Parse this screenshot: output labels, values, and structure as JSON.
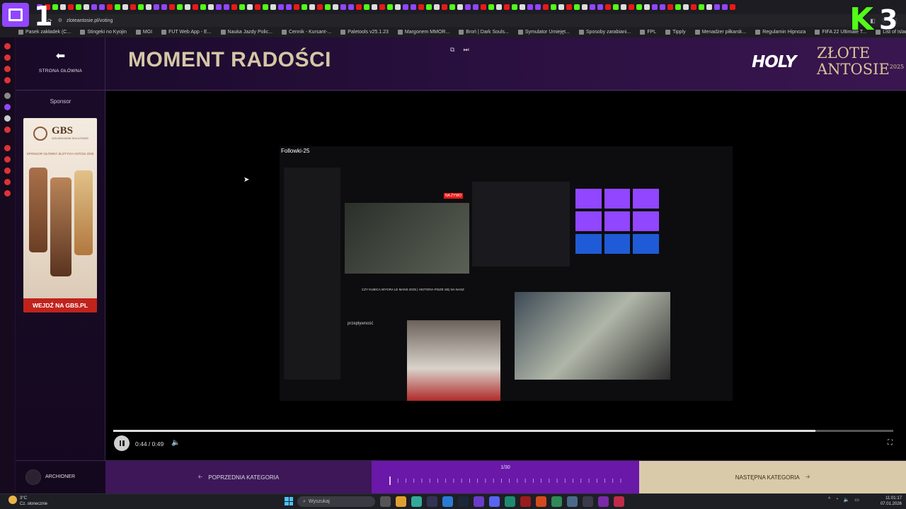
{
  "browser": {
    "url": "zloteantosie.pl/voting",
    "bookmarks": [
      "Pasek zakładek (C...",
      "Stingeki no Kyojin",
      "MGI",
      "FUT Web App - E...",
      "Nauka Jazdy Polic...",
      "Cennik - Kursant-...",
      "Paletools v25.1.23",
      "Margonem MMOR...",
      "Broń | Dark Souls...",
      "Symulator Umiejęt...",
      "Sposoby zarabiani...",
      "FPL",
      "Tipply",
      "Menadżer piłkarsk...",
      "Regulamin Hipnoza",
      "FIFA 22 Ultimate T...",
      "List of Islamic Terr..."
    ]
  },
  "overlay": {
    "left_number": "1",
    "right_number": "3"
  },
  "header": {
    "back_label": "STRONA GŁÓWNA",
    "title": "MOMENT RADOŚCI",
    "logo_holy": "HOLY",
    "logo_zlote": "ZŁOTE",
    "logo_antosie": "ANTOSIE",
    "logo_year": "2025"
  },
  "sponsor": {
    "label": "Sponsor",
    "brand": "GBS",
    "brand_sub": "GOLDEN BOW SOLUTIONS",
    "tagline": "SPONSOR GŁÓWNY ZŁOTYCH ANTOSI 2025",
    "cta": "WEJDŹ NA GBS.PL"
  },
  "video": {
    "current_time": "0:44",
    "duration": "0:49",
    "time_display": "0:44 / 0:49",
    "progress_percent": 90,
    "inner_title": "Followki-25",
    "inner_subtitle": "CZY KUBICA WYGRA LE MANS 2025 | HISTORIA PISZE SIĘ NA NASZ",
    "inner_live": "NA ŻYWO",
    "inner_chat_line": "przepływność"
  },
  "footer": {
    "archive_label": "ARCHIONER",
    "prev_label": "POPRZEDNIA KATEGORIA",
    "pager": "1/30",
    "next_label": "NASTĘPNA KATEGORIA"
  },
  "taskbar": {
    "temp": "3°C",
    "weather": "Cz. słonecznie",
    "search_placeholder": "Wyszukaj",
    "time": "11:01:17",
    "date": "07.01.2026"
  },
  "colors": {
    "accent": "#6a18a8",
    "title": "#d6c7a6",
    "next_bg": "#d9cba9",
    "cta": "#c0231c"
  }
}
